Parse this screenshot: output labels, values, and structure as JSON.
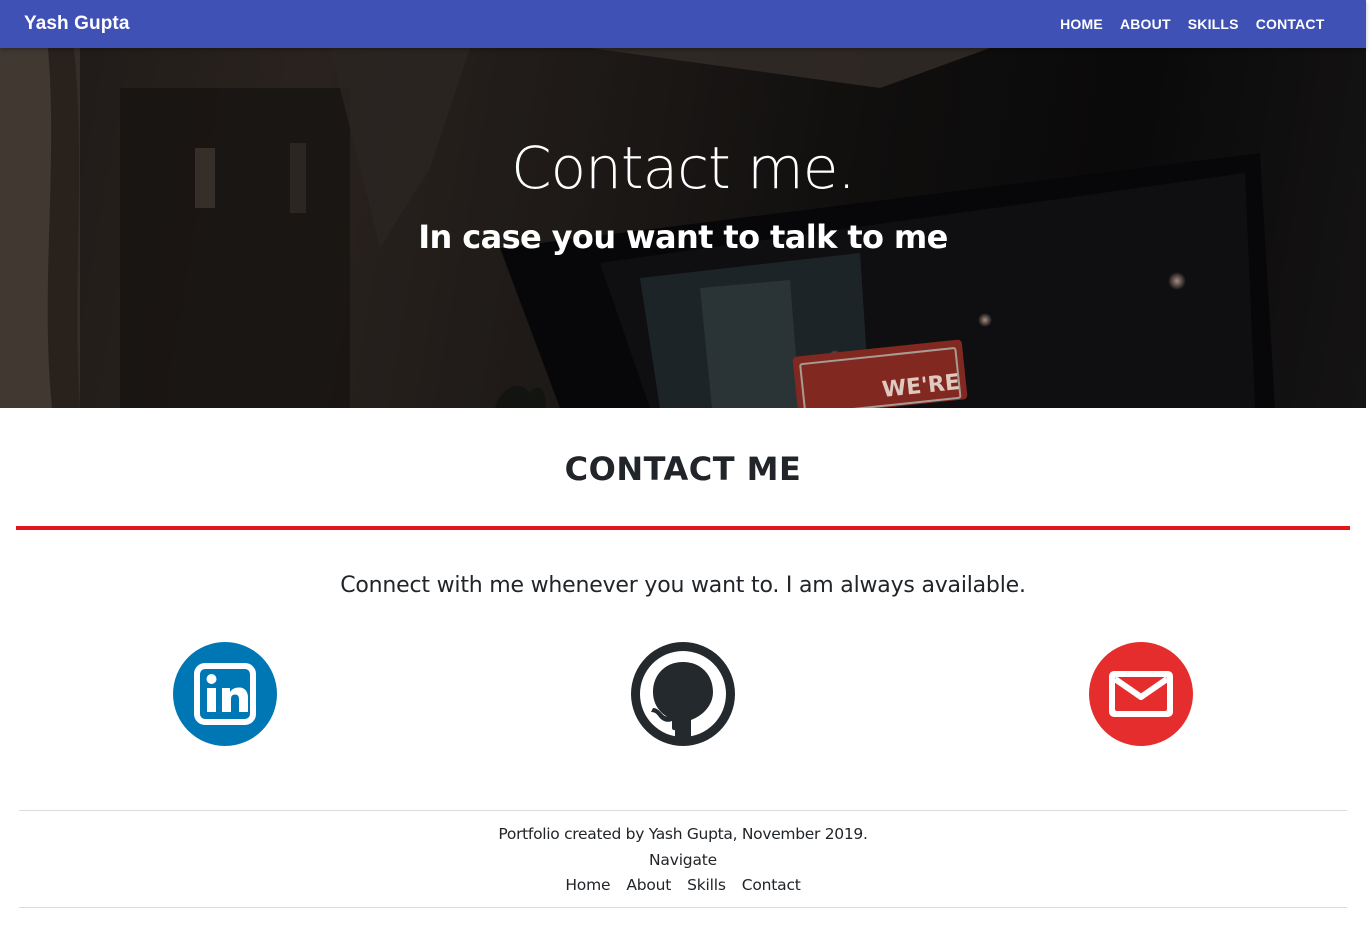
{
  "navbar": {
    "brand": "Yash Gupta",
    "links": [
      "HOME",
      "ABOUT",
      "SKILLS",
      "CONTACT"
    ],
    "background_color": "#3f51b5"
  },
  "hero": {
    "title": "Contact me.",
    "subtitle": "In case you want to talk to me",
    "sign_text": "WE'RE"
  },
  "contact": {
    "heading": "CONTACT ME",
    "tagline": "Connect with me whenever you want to. I am always available.",
    "accent_color": "#e3141b",
    "social": [
      {
        "icon": "linkedin-icon",
        "color": "#0077b5"
      },
      {
        "icon": "github-icon",
        "color": "#24292e"
      },
      {
        "icon": "email-icon",
        "color": "#e52d2d"
      }
    ]
  },
  "footer": {
    "credit": "Portfolio created by Yash Gupta, November 2019.",
    "navigate_label": "Navigate",
    "links": [
      "Home",
      "About",
      "Skills",
      "Contact"
    ]
  }
}
